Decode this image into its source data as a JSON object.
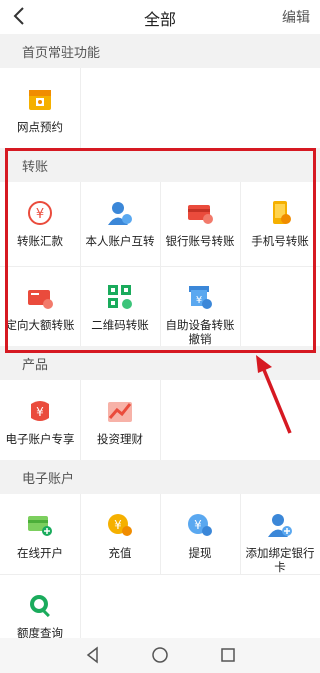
{
  "header": {
    "title": "全部",
    "edit_label": "编辑"
  },
  "sections": {
    "resident": {
      "title": "首页常驻功能",
      "items": [
        {
          "label": "网点预约",
          "icon": "calendar-store-icon"
        }
      ]
    },
    "transfer": {
      "title": "转账",
      "items": [
        {
          "label": "转账汇款",
          "icon": "transfer-remit-icon"
        },
        {
          "label": "本人账户互转",
          "icon": "own-account-transfer-icon"
        },
        {
          "label": "银行账号转账",
          "icon": "bank-card-transfer-icon"
        },
        {
          "label": "手机号转账",
          "icon": "phone-transfer-icon"
        },
        {
          "label": "定向大额转账",
          "icon": "large-transfer-icon"
        },
        {
          "label": "二维码转账",
          "icon": "qr-code-transfer-icon"
        },
        {
          "label": "自助设备转账撤销",
          "icon": "atm-cancel-icon"
        }
      ]
    },
    "products": {
      "title": "产品",
      "items": [
        {
          "label": "电子账户专享",
          "icon": "e-account-exclusive-icon"
        },
        {
          "label": "投资理财",
          "icon": "investment-icon"
        }
      ]
    },
    "eaccount": {
      "title": "电子账户",
      "items": [
        {
          "label": "在线开户",
          "icon": "open-account-icon"
        },
        {
          "label": "充值",
          "icon": "recharge-icon"
        },
        {
          "label": "提现",
          "icon": "withdraw-icon"
        },
        {
          "label": "添加绑定银行卡",
          "icon": "add-bind-card-icon"
        },
        {
          "label": "额度查询",
          "icon": "limit-query-icon"
        }
      ]
    }
  },
  "colors": {
    "highlight": "#d61922",
    "orange": "#f5a623",
    "red": "#ea4b3c",
    "blue": "#3b87d8",
    "green": "#1aab5c"
  }
}
